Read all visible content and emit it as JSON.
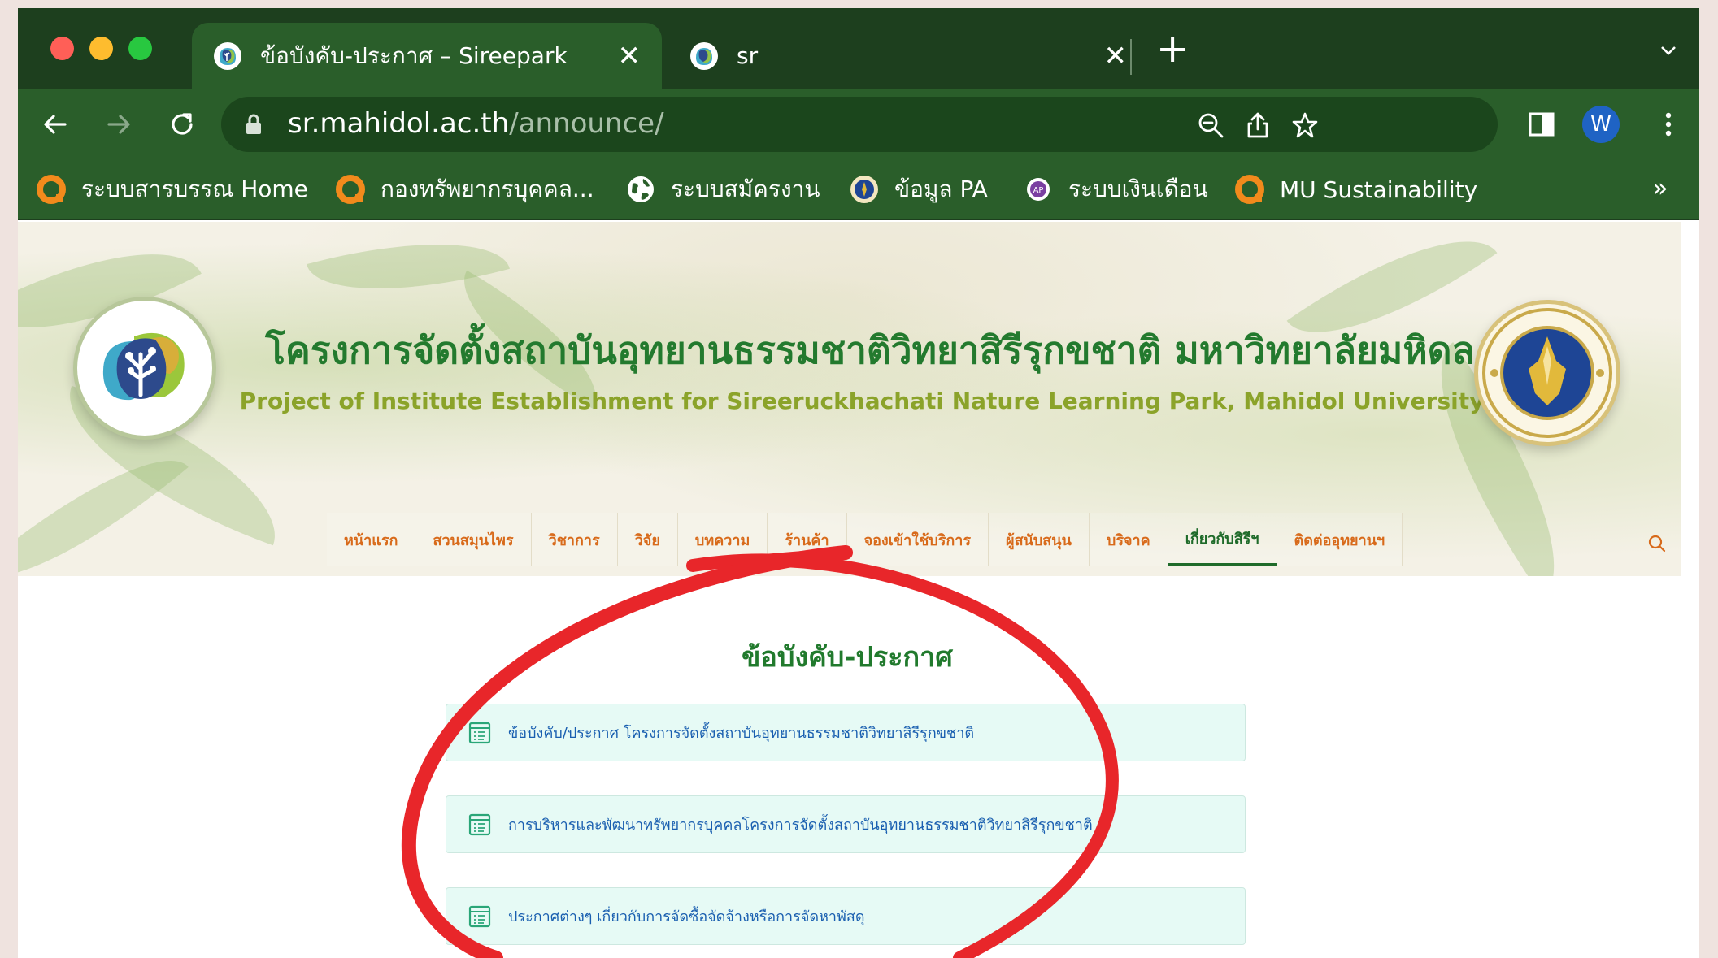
{
  "browser": {
    "tabs": [
      {
        "title": "ข้อบังคับ-ประกาศ – Sireepark",
        "active": true
      },
      {
        "title": "sr",
        "active": false
      }
    ],
    "address": {
      "host": "sr.mahidol.ac.th",
      "path": "/announce/"
    },
    "profile_initial": "W",
    "bookmarks": [
      {
        "label": "ระบบสารบรรณ Home",
        "icon": "orange-ring-icon"
      },
      {
        "label": "กองทรัพยากรบุคคล...",
        "icon": "orange-ring-icon"
      },
      {
        "label": "ระบบสมัครงาน",
        "icon": "globe-icon"
      },
      {
        "label": "ข้อมูล PA",
        "icon": "seal-icon"
      },
      {
        "label": "ระบบเงินเดือน",
        "icon": "purple-badge-icon"
      },
      {
        "label": "MU Sustainability",
        "icon": "orange-ring-icon"
      }
    ],
    "bookmarks_overflow": "»"
  },
  "site": {
    "title_th": "โครงการจัดตั้งสถาบันอุทยานธรรมชาติวิทยาสิรีรุกขชาติ มหาวิทยาลัยมหิดล",
    "title_en": "Project of Institute Establishment for Sireeruckhachati Nature Learning Park, Mahidol University",
    "nav": [
      {
        "label": "หน้าแรก",
        "active": false
      },
      {
        "label": "สวนสมุนไพร",
        "active": false
      },
      {
        "label": "วิชาการ",
        "active": false
      },
      {
        "label": "วิจัย",
        "active": false
      },
      {
        "label": "บทความ",
        "active": false
      },
      {
        "label": "ร้านค้า",
        "active": false
      },
      {
        "label": "จองเข้าใช้บริการ",
        "active": false
      },
      {
        "label": "ผู้สนับสนุน",
        "active": false
      },
      {
        "label": "บริจาค",
        "active": false
      },
      {
        "label": "เกี่ยวกับสิรีฯ",
        "active": true
      },
      {
        "label": "ติดต่ออุทยานฯ",
        "active": false
      }
    ]
  },
  "page": {
    "title": "ข้อบังคับ-ประกาศ",
    "items": [
      {
        "label": "ข้อบังคับ/ประกาศ โครงการจัดตั้งสถาบันอุทยานธรรมชาติวิทยาสิรีรุกขชาติ"
      },
      {
        "label": "การบริหารและพัฒนาทรัพยากรบุคคลโครงการจัดตั้งสถาบันอุทยานธรรมชาติวิทยาสิรีรุกขชาติ"
      },
      {
        "label": "ประกาศต่างๆ เกี่ยวกับการจัดซื้อจัดจ้างหรือการจัดหาพัสดุ"
      }
    ]
  },
  "colors": {
    "chrome_dark": "#1d3f1e",
    "chrome": "#2a5e2a",
    "nav_text": "#d86a1a",
    "nav_active": "#1f6b2a",
    "item_bg": "#e6faf5",
    "item_text": "#1a5fb0",
    "annotation": "#e8262a"
  }
}
